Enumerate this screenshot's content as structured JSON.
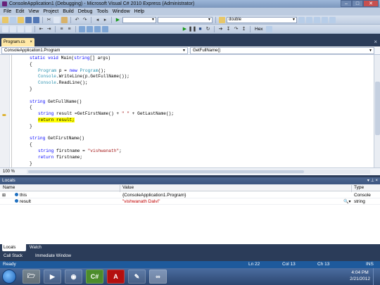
{
  "window": {
    "title": "ConsoleApplication1 (Debugging) - Microsoft Visual C# 2010 Express (Administrator)",
    "controls": [
      "–",
      "□",
      "✕"
    ]
  },
  "menu": [
    "File",
    "Edit",
    "View",
    "Project",
    "Build",
    "Debug",
    "Tools",
    "Window",
    "Help"
  ],
  "toolbar": {
    "find_combo": "double",
    "hex_label": "Hex"
  },
  "tabs": {
    "active": "Program.cs",
    "close": "×"
  },
  "navbar": {
    "class_combo": "ConsoleApplication1.Program",
    "member_combo": "GetFullName()"
  },
  "code_lines": [
    {
      "indent": 3,
      "parts": [
        [
          "kw",
          "static "
        ],
        [
          "kw",
          "void "
        ],
        [
          "",
          "Main("
        ],
        [
          "kw",
          "string"
        ],
        [
          "",
          "[] args)"
        ]
      ]
    },
    {
      "indent": 3,
      "parts": [
        [
          "",
          "{"
        ]
      ]
    },
    {
      "indent": 5,
      "parts": [
        [
          "ty",
          "Program"
        ],
        [
          "",
          " p = "
        ],
        [
          "kw",
          "new "
        ],
        [
          "ty",
          "Program"
        ],
        [
          "",
          "();"
        ]
      ]
    },
    {
      "indent": 5,
      "parts": [
        [
          "ty",
          "Console"
        ],
        [
          "",
          ".WriteLine(p.GetFullName());"
        ]
      ]
    },
    {
      "indent": 5,
      "parts": [
        [
          "ty",
          "Console"
        ],
        [
          "",
          ".ReadLine();"
        ]
      ]
    },
    {
      "indent": 3,
      "parts": [
        [
          "",
          "}"
        ]
      ]
    },
    {
      "indent": 0,
      "parts": []
    },
    {
      "indent": 3,
      "parts": [
        [
          "kw",
          "string "
        ],
        [
          "",
          "GetFullName()"
        ]
      ]
    },
    {
      "indent": 3,
      "parts": [
        [
          "",
          "{"
        ]
      ]
    },
    {
      "indent": 5,
      "parts": [
        [
          "kw",
          "string "
        ],
        [
          "",
          "result =GetFirstName() + "
        ],
        [
          "st",
          "\" \""
        ],
        [
          "",
          " + GetLastName();"
        ]
      ]
    },
    {
      "indent": 5,
      "parts": [
        [
          "hl",
          "return result;"
        ]
      ]
    },
    {
      "indent": 3,
      "parts": [
        [
          "",
          "}"
        ]
      ]
    },
    {
      "indent": 0,
      "parts": []
    },
    {
      "indent": 3,
      "parts": [
        [
          "kw",
          "string "
        ],
        [
          "",
          "GetFirstName()"
        ]
      ]
    },
    {
      "indent": 3,
      "parts": [
        [
          "",
          "{"
        ]
      ]
    },
    {
      "indent": 5,
      "parts": [
        [
          "kw",
          "string "
        ],
        [
          "",
          "firstname = "
        ],
        [
          "st",
          "\"vishwanath\""
        ],
        [
          "",
          ";"
        ]
      ]
    },
    {
      "indent": 5,
      "parts": [
        [
          "kw",
          "return "
        ],
        [
          "",
          "firstname;"
        ]
      ]
    },
    {
      "indent": 3,
      "parts": [
        [
          "",
          "}"
        ]
      ]
    }
  ],
  "zoom": "100 %",
  "locals": {
    "title": "Locals",
    "headers": {
      "name": "Name",
      "value": "Value",
      "type": "Type"
    },
    "rows": [
      {
        "name": "this",
        "value": "{ConsoleApplication1.Program}",
        "type": "Console"
      },
      {
        "name": "result",
        "value": "\"vishwanath Dalvi\"",
        "type": "string"
      }
    ]
  },
  "bottom_tabs": {
    "locals": "Locals",
    "watch": "Watch",
    "call_stack": "Call Stack",
    "immediate": "Immediate Window"
  },
  "status": {
    "ready": "Ready",
    "ln": "Ln 22",
    "col": "Col 13",
    "ch": "Ch 13",
    "ins": "INS"
  },
  "taskbar": {
    "time": "4:04 PM",
    "date": "2/21/2012"
  }
}
